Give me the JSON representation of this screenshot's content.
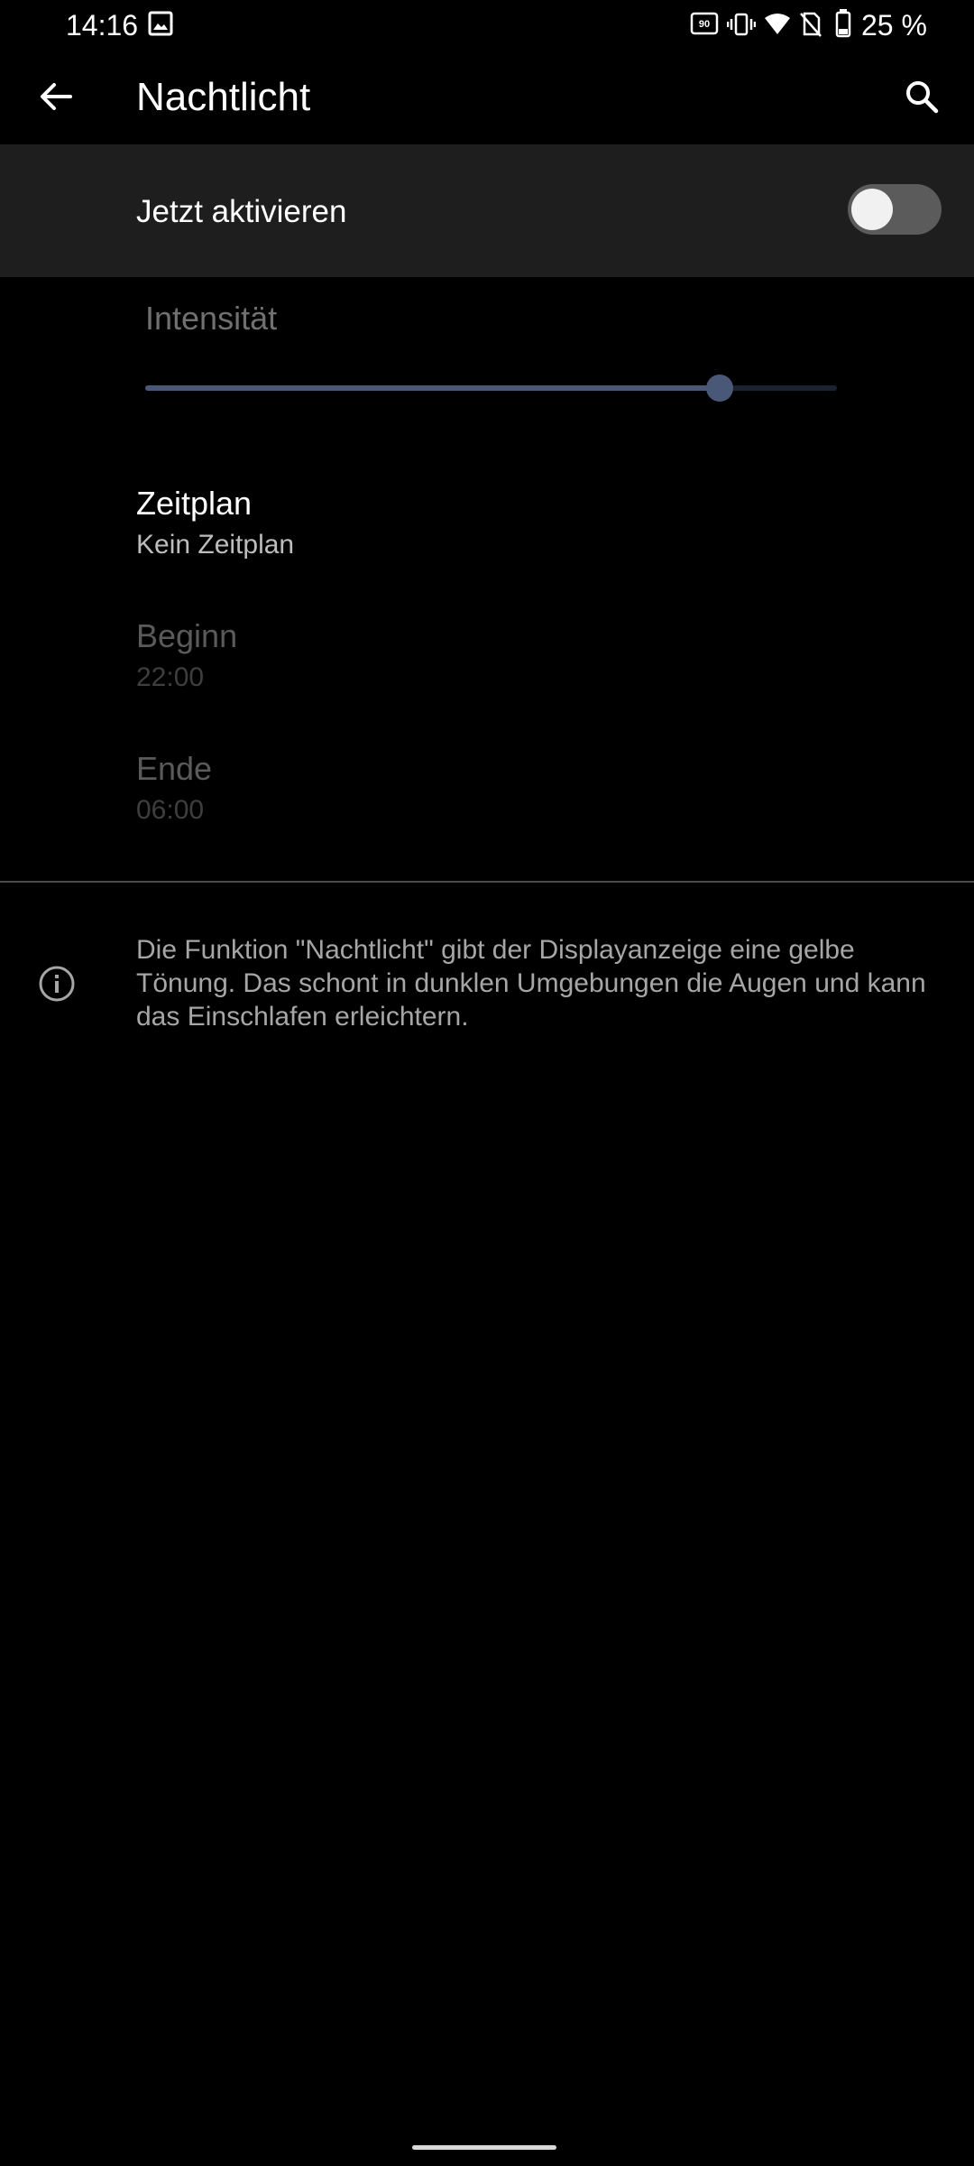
{
  "status_bar": {
    "time": "14:16",
    "battery": "25 %",
    "icons": [
      "image-icon",
      "refresh-rate-90hz-icon",
      "vibrate-icon",
      "wifi-icon",
      "no-sim-icon",
      "battery-icon"
    ]
  },
  "app_bar": {
    "title": "Nachtlicht",
    "back_icon": "arrow-back-icon",
    "search_icon": "search-icon"
  },
  "main_switch": {
    "label": "Jetzt aktivieren",
    "enabled": false
  },
  "intensity": {
    "label": "Intensität",
    "value_fraction": 0.83,
    "enabled": false,
    "accent": "#4a5877"
  },
  "schedule": {
    "title": "Zeitplan",
    "value": "Kein Zeitplan"
  },
  "start": {
    "title": "Beginn",
    "value": "22:00",
    "enabled": false
  },
  "end": {
    "title": "Ende",
    "value": "06:00",
    "enabled": false
  },
  "footer": {
    "info_icon": "info-icon",
    "text": "Die Funktion \"Nachtlicht\" gibt der Displayanzeige eine gelbe Tönung. Das schont in dunklen Umgebungen die Augen und kann das Einschlafen erleichtern."
  }
}
